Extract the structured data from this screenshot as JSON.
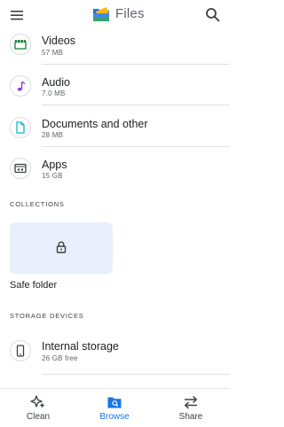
{
  "app": {
    "title": "Files"
  },
  "categories": [
    {
      "title": "Videos",
      "subtitle": "57 MB",
      "icon": "clapperboard-icon",
      "color": "#188038"
    },
    {
      "title": "Audio",
      "subtitle": "7.0 MB",
      "icon": "music-note-icon",
      "color": "#9334e6"
    },
    {
      "title": "Documents and other",
      "subtitle": "28 MB",
      "icon": "document-icon",
      "color": "#12b5cb"
    },
    {
      "title": "Apps",
      "subtitle": "15 GB",
      "icon": "apps-icon",
      "color": "#3c4043"
    }
  ],
  "collections": {
    "label": "COLLECTIONS",
    "safe_folder": "Safe folder"
  },
  "storage": {
    "label": "STORAGE DEVICES",
    "internal_title": "Internal storage",
    "internal_sub": "26 GB free"
  },
  "bottom_nav": [
    {
      "label": "Clean",
      "icon": "sparkle-icon",
      "active": false
    },
    {
      "label": "Browse",
      "icon": "browse-folder-icon",
      "active": true
    },
    {
      "label": "Share",
      "icon": "swap-arrows-icon",
      "active": false
    }
  ],
  "colors": {
    "accent": "#1a73e8",
    "card_bg": "#e8eefb"
  }
}
